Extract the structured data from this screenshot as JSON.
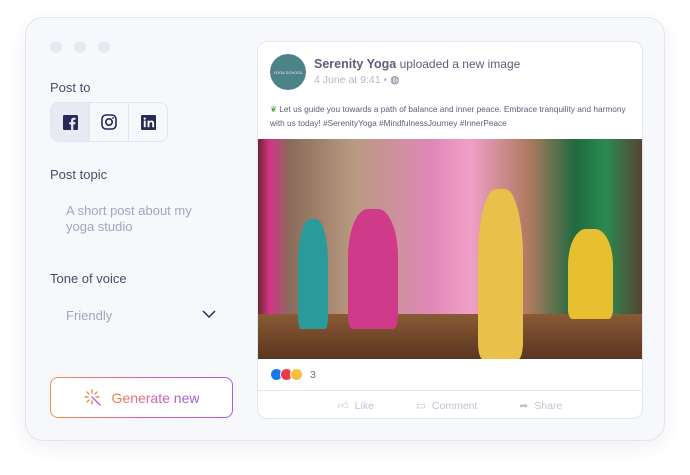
{
  "left": {
    "post_to_label": "Post to",
    "networks": [
      {
        "name": "Facebook",
        "selected": true
      },
      {
        "name": "Instagram",
        "selected": false
      },
      {
        "name": "LinkedIn",
        "selected": false
      }
    ],
    "topic_label": "Post topic",
    "topic_placeholder": "A short post about my yoga studio",
    "tone_label": "Tone of voice",
    "tone_value": "Friendly",
    "generate_label": "Generate new"
  },
  "post": {
    "page_name": "Serenity Yoga",
    "action": "uploaded a new image",
    "date": "4 June at 9:41",
    "separator": "•",
    "avatar_text": "YOGA SCHOOL",
    "text": "Let us guide you towards a path of balance and inner peace. Embrace tranquility and harmony with us today! #SerenityYoga #MindfulnessJourney #InnerPeace",
    "reaction_count": "3",
    "actions": {
      "like": "Like",
      "comment": "Comment",
      "share": "Share"
    }
  },
  "colors": {
    "accent_start": "#f6914a",
    "accent_end": "#a85cf0",
    "facebook_blue": "#1877f2"
  }
}
